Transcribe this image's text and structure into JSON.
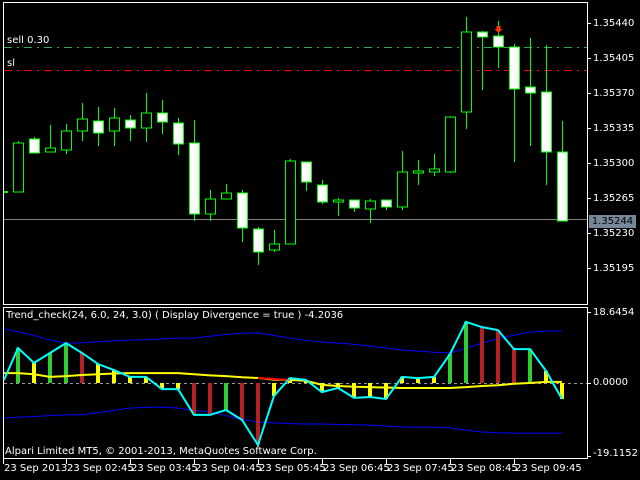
{
  "colors": {
    "background": "#000000",
    "frame": "#ffffff",
    "candle": "#00ff00",
    "bull_fill": "#000000",
    "bear_fill": "#ffffff",
    "sell_line": "#32a852",
    "sl_line": "#ff0000",
    "bid_line": "#808080",
    "bid_tag": "#778899",
    "hist_up": "#32cd32",
    "hist_down": "#b22222",
    "hist_neutral": "#ffff00",
    "osc_line": "#00ffff",
    "signal_line": "#ffff00",
    "band": "#0000ff",
    "arrow": "#ff3300"
  },
  "main_chart": {
    "price_axis": [
      "1.35440",
      "1.35405",
      "1.35370",
      "1.35335",
      "1.35300",
      "1.35265",
      "1.35230",
      "1.35195"
    ],
    "bid_price": "1.35244",
    "lines": [
      {
        "label": "sell 0.30",
        "price": 1.35416,
        "kind": "sell"
      },
      {
        "label": "sl",
        "price": 1.35393,
        "kind": "sl"
      }
    ],
    "candles_ohlc": [
      [
        1.35271,
        1.35322,
        1.35271,
        1.3532
      ],
      [
        1.35324,
        1.35326,
        1.3531,
        1.3531
      ],
      [
        1.35311,
        1.35338,
        1.35311,
        1.35315
      ],
      [
        1.35313,
        1.35339,
        1.35309,
        1.35332
      ],
      [
        1.35332,
        1.3536,
        1.35322,
        1.35344
      ],
      [
        1.35342,
        1.35356,
        1.35317,
        1.3533
      ],
      [
        1.35332,
        1.35355,
        1.35317,
        1.35345
      ],
      [
        1.35343,
        1.35348,
        1.35322,
        1.35335
      ],
      [
        1.35335,
        1.3537,
        1.35321,
        1.3535
      ],
      [
        1.3535,
        1.35363,
        1.35329,
        1.35341
      ],
      [
        1.3534,
        1.35345,
        1.35308,
        1.35319
      ],
      [
        1.3532,
        1.35343,
        1.35242,
        1.35249
      ],
      [
        1.35249,
        1.35273,
        1.35242,
        1.35264
      ],
      [
        1.35264,
        1.35279,
        1.35264,
        1.3527
      ],
      [
        1.3527,
        1.35273,
        1.35221,
        1.35235
      ],
      [
        1.35234,
        1.35236,
        1.35198,
        1.35211
      ],
      [
        1.35213,
        1.35233,
        1.35211,
        1.35219
      ],
      [
        1.35219,
        1.35304,
        1.35219,
        1.35302
      ],
      [
        1.35301,
        1.35301,
        1.35272,
        1.35281
      ],
      [
        1.35278,
        1.35283,
        1.35259,
        1.35261
      ],
      [
        1.35261,
        1.35265,
        1.35247,
        1.35263
      ],
      [
        1.35263,
        1.35263,
        1.35251,
        1.35255
      ],
      [
        1.35254,
        1.35264,
        1.3524,
        1.35262
      ],
      [
        1.35263,
        1.35263,
        1.35253,
        1.35256
      ],
      [
        1.35256,
        1.35312,
        1.35253,
        1.35291
      ],
      [
        1.3529,
        1.35303,
        1.35278,
        1.35292
      ],
      [
        1.35291,
        1.35309,
        1.35287,
        1.35294
      ],
      [
        1.35291,
        1.35347,
        1.3529,
        1.35346
      ],
      [
        1.35351,
        1.35446,
        1.35334,
        1.35431
      ],
      [
        1.35431,
        1.35432,
        1.35373,
        1.35426
      ],
      [
        1.35427,
        1.35442,
        1.35395,
        1.35416
      ],
      [
        1.35416,
        1.35419,
        1.35301,
        1.35374
      ],
      [
        1.35376,
        1.35425,
        1.35317,
        1.3537
      ],
      [
        1.35371,
        1.35418,
        1.35278,
        1.35311
      ],
      [
        1.35311,
        1.35342,
        1.35242,
        1.35242
      ]
    ],
    "sell_arrow_candle_index": 30
  },
  "indicator": {
    "title": "Trend_check(24, 6.0, 24, 3.0) ( Display Divergence = true ) -4.2036",
    "axis_max": "18.6454",
    "axis_zero": "0.0000",
    "axis_min": "-19.1152",
    "histogram": [
      9.2,
      5.3,
      7.9,
      10.5,
      7.9,
      5.0,
      3.4,
      1.6,
      1.6,
      -1.6,
      -1.6,
      -8.4,
      -8.4,
      -7.1,
      -9.7,
      -16.3,
      -3.4,
      1.3,
      0.8,
      -2.4,
      -1.3,
      -3.9,
      -3.7,
      -4.2,
      1.6,
      1.3,
      1.6,
      7.6,
      16.1,
      14.7,
      13.9,
      8.9,
      8.9,
      3.2,
      -4.2
    ],
    "histogram_colors": [
      "up",
      "neutral",
      "up",
      "up",
      "down",
      "neutral",
      "neutral",
      "neutral",
      "neutral",
      "neutral",
      "neutral",
      "down",
      "down",
      "up",
      "down",
      "down",
      "neutral",
      "neutral",
      "neutral",
      "neutral",
      "neutral",
      "neutral",
      "neutral",
      "neutral",
      "neutral",
      "neutral",
      "neutral",
      "up",
      "up",
      "down",
      "down",
      "down",
      "up",
      "neutral",
      "neutral"
    ],
    "signal": [
      2.6,
      2.3,
      1.6,
      1.8,
      2.1,
      2.3,
      2.5,
      2.6,
      2.6,
      2.6,
      2.6,
      2.3,
      2.0,
      1.8,
      1.5,
      1.3,
      0.9,
      0.8,
      0.6,
      -0.5,
      -0.8,
      -1.0,
      -1.1,
      -1.2,
      -1.3,
      -1.3,
      -1.3,
      -1.3,
      -1.1,
      -0.8,
      -0.6,
      -0.2,
      0.0,
      0.3,
      0.3
    ],
    "upper_band": [
      13.5,
      12.5,
      11.3,
      10.5,
      10.6,
      10.9,
      11.1,
      11.3,
      11.4,
      11.6,
      11.8,
      11.8,
      12.3,
      12.8,
      13.1,
      13.2,
      12.5,
      11.8,
      11.2,
      10.8,
      10.5,
      10.2,
      9.7,
      9.2,
      8.7,
      8.4,
      8.1,
      7.9,
      9.2,
      10.5,
      11.7,
      12.6,
      13.4,
      13.7,
      13.7
    ],
    "lower_band": [
      -9.0,
      -8.8,
      -8.6,
      -8.4,
      -8.4,
      -7.8,
      -7.2,
      -6.6,
      -6.4,
      -6.3,
      -6.6,
      -7.2,
      -7.6,
      -8.6,
      -9.6,
      -10.3,
      -10.5,
      -10.7,
      -10.8,
      -10.8,
      -10.9,
      -11.0,
      -11.1,
      -11.3,
      -11.6,
      -11.6,
      -11.6,
      -11.8,
      -12.4,
      -12.9,
      -13.1,
      -13.2,
      -13.2,
      -13.2,
      -13.2
    ]
  },
  "copyright": "Alpari Limited MT5, © 2001-2013, MetaQuotes Software Corp.",
  "time_axis": [
    "23 Sep 2013",
    "23 Sep 02:45",
    "23 Sep 03:45",
    "23 Sep 04:45",
    "23 Sep 05:45",
    "23 Sep 06:45",
    "23 Sep 07:45",
    "23 Sep 08:45",
    "23 Sep 09:45"
  ]
}
